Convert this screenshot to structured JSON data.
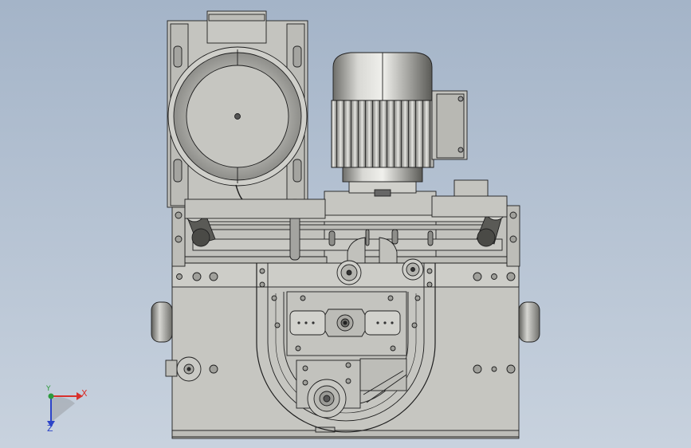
{
  "viewport": {
    "background_top": "#a4b4c8",
    "background_bottom": "#c8d2de"
  },
  "model": {
    "body_color": "#c9c9c4",
    "edge_color": "#1e1e1e",
    "motor_metal": "#9a9a96"
  },
  "triad": {
    "x_label": "X",
    "y_label": "Y",
    "z_label": "Z",
    "x_color": "#d8302c",
    "y_color": "#2c9a3c",
    "z_color": "#2c44c8"
  }
}
